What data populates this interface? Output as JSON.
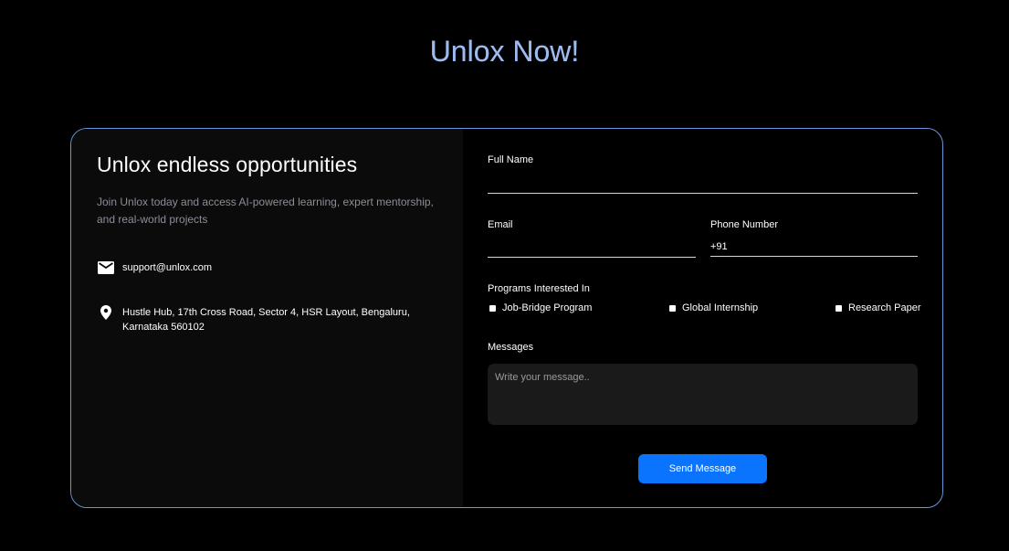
{
  "hero": {
    "title": "Unlox Now!"
  },
  "info": {
    "heading": "Unlox endless opportunities",
    "description": "Join Unlox today and access AI-powered learning, expert mentorship, and real-world projects",
    "email": "support@unlox.com",
    "address": "Hustle Hub, 17th Cross Road, Sector 4, HSR Layout, Bengaluru, Karnataka 560102",
    "email_icon": "mail-icon",
    "address_icon": "location-pin-icon"
  },
  "form": {
    "full_name_label": "Full Name",
    "full_name_value": "",
    "email_label": "Email",
    "email_value": "",
    "phone_label": "Phone Number",
    "phone_value": "+91",
    "programs_label": "Programs Interested In",
    "programs": [
      {
        "label": "Job-Bridge Program",
        "checked": false
      },
      {
        "label": "Global Internship",
        "checked": false
      },
      {
        "label": "Research Paper",
        "checked": false
      }
    ],
    "messages_label": "Messages",
    "messages_placeholder": "Write your message..",
    "send_label": "Send Message"
  },
  "colors": {
    "accent": "#0a74ff",
    "card_border": "#6b95de",
    "title_gradient_start": "#7fa7f0",
    "title_gradient_end": "#a9c3ef"
  }
}
